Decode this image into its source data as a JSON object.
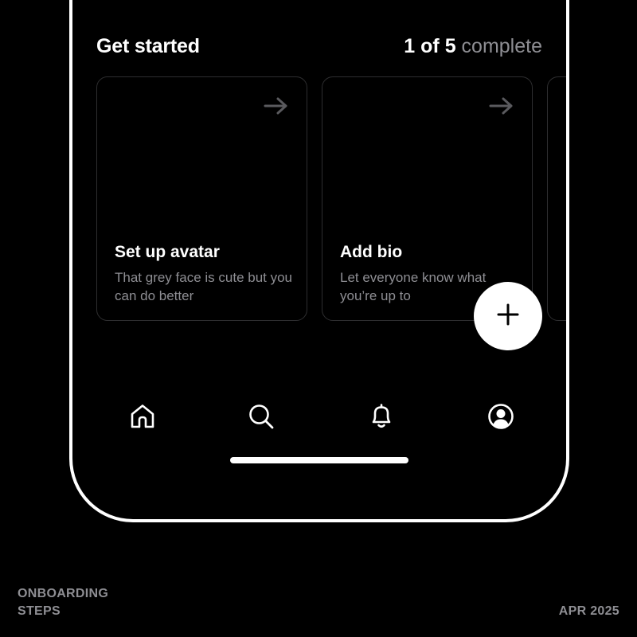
{
  "section": {
    "title": "Get started",
    "progress_count": "1 of 5",
    "progress_label": "complete"
  },
  "cards": [
    {
      "title": "Set up avatar",
      "description": "That grey face is cute but you can do better",
      "icon": "arrow-right-icon"
    },
    {
      "title": "Add bio",
      "description": "Let everyone know what you’re up to",
      "icon": "arrow-right-icon"
    }
  ],
  "fab": {
    "icon": "plus-icon"
  },
  "tabbar": {
    "items": [
      {
        "icon": "home-icon"
      },
      {
        "icon": "search-icon"
      },
      {
        "icon": "bell-icon"
      },
      {
        "icon": "profile-icon"
      }
    ]
  },
  "footer": {
    "left_label": "ONBOARDING STEPS",
    "right_label": "APR 2025"
  },
  "colors": {
    "background": "#000000",
    "foreground": "#ffffff",
    "secondary_text": "#8e8e93",
    "card_border": "#2e2e30",
    "arrow": "#5a5a5e"
  }
}
